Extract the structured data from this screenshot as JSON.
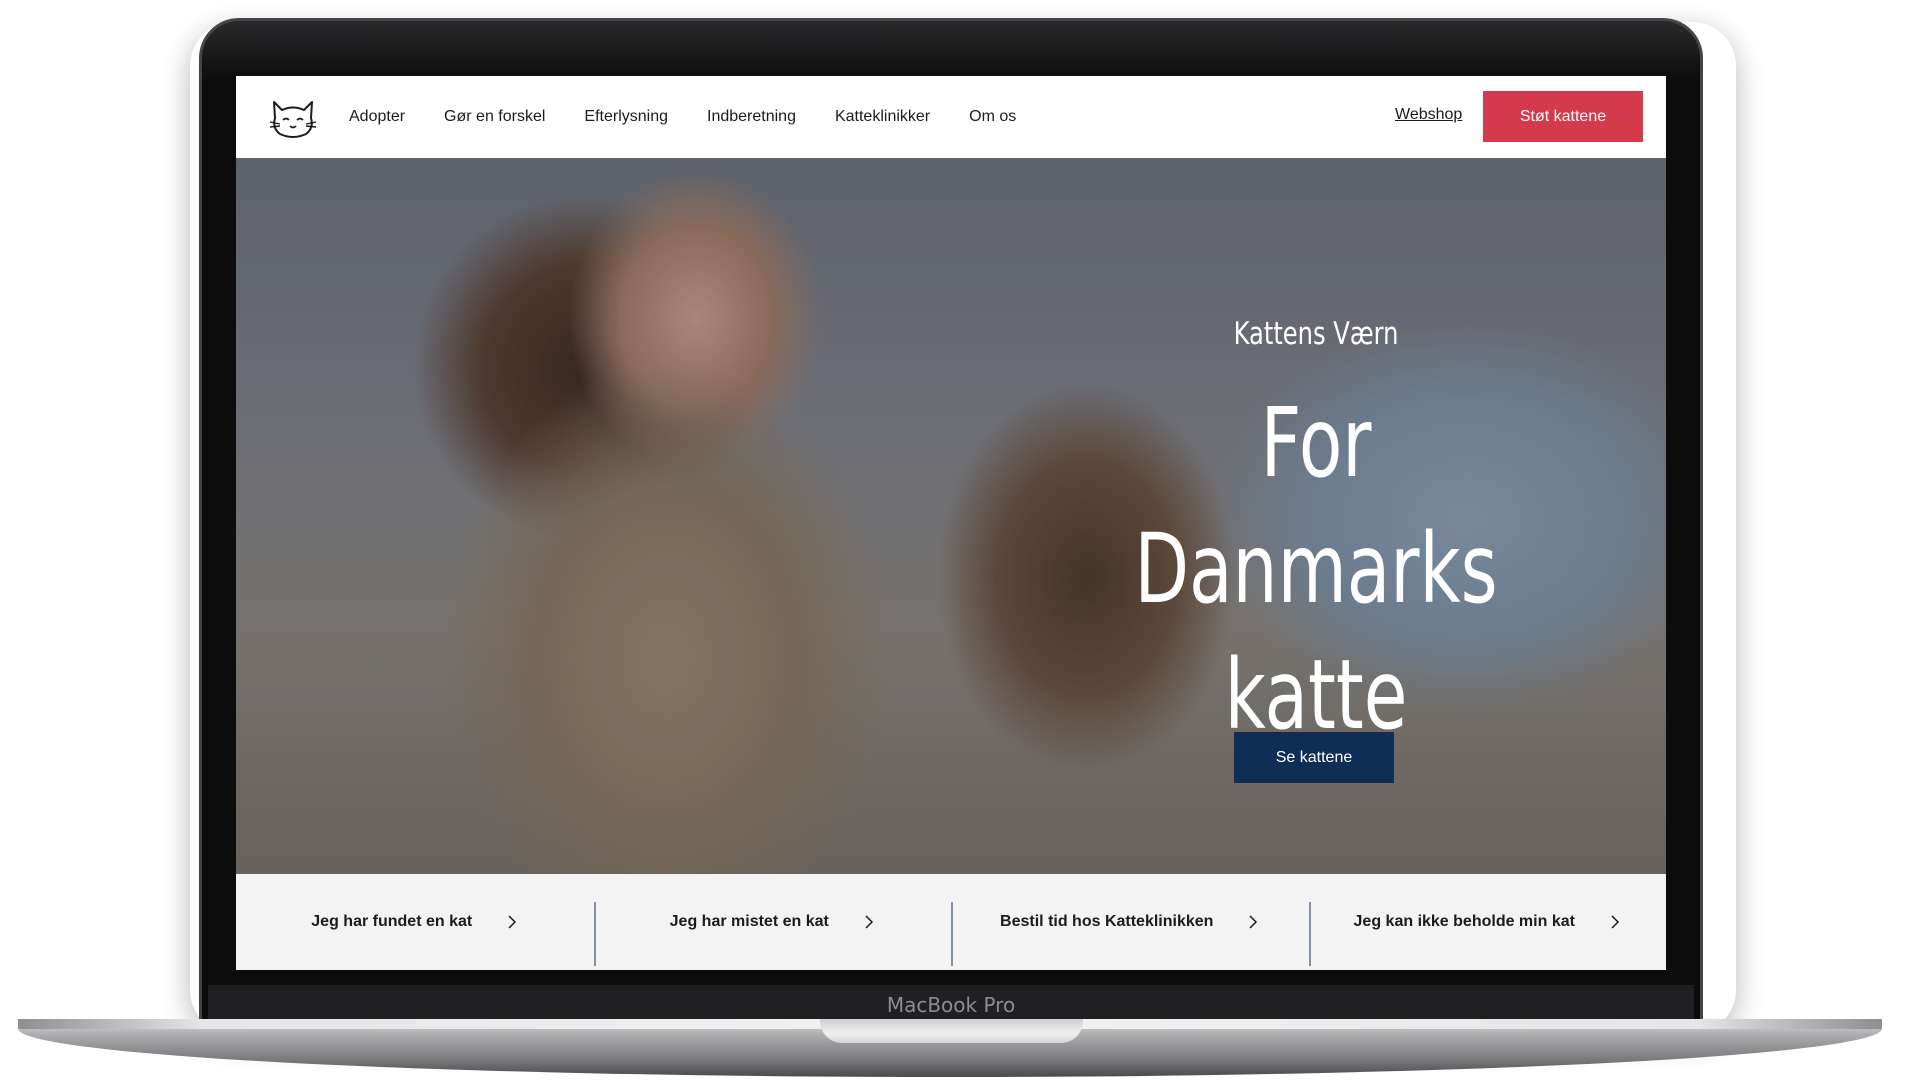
{
  "device": {
    "model_label": "MacBook Pro"
  },
  "site": {
    "nav": {
      "links": [
        "Adopter",
        "Gør en forskel",
        "Efterlysning",
        "Indberetning",
        "Katteklinikker",
        "Om os"
      ],
      "webshop": "Webshop",
      "cta": "Støt kattene"
    },
    "hero": {
      "eyebrow": "Kattens Værn",
      "title": "For Danmarks katte",
      "button": "Se kattene"
    },
    "quick_links": [
      "Jeg har fundet en kat",
      "Jeg har mistet en kat",
      "Bestil tid hos Katteklinikken",
      "Jeg kan ikke beholde min kat"
    ],
    "colors": {
      "cta": "#d4394c",
      "hero_button": "#0e2e55"
    }
  }
}
